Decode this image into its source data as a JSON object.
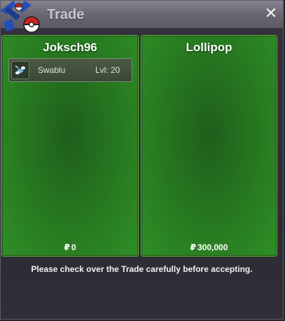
{
  "window": {
    "title": "Trade",
    "close_symbol": "✕",
    "icons": [
      "pokeball-logo-icon",
      "close-icon"
    ]
  },
  "trade": {
    "left": {
      "name": "Joksch96",
      "items": [
        {
          "name": "Swablu",
          "level": "Lvl: 20",
          "icon": "swablu-icon"
        }
      ],
      "currency_symbol": "₽",
      "money": "0"
    },
    "right": {
      "name": "Lollipop",
      "items": [],
      "currency_symbol": "₽",
      "money": "300,000"
    }
  },
  "notice": "Please check over the Trade carefully before accepting.",
  "colors": {
    "panel_green": "#2f8f26",
    "panel_border": "#66b83a",
    "title_bar": "#75727e",
    "window_bg": "#2c2b33"
  }
}
